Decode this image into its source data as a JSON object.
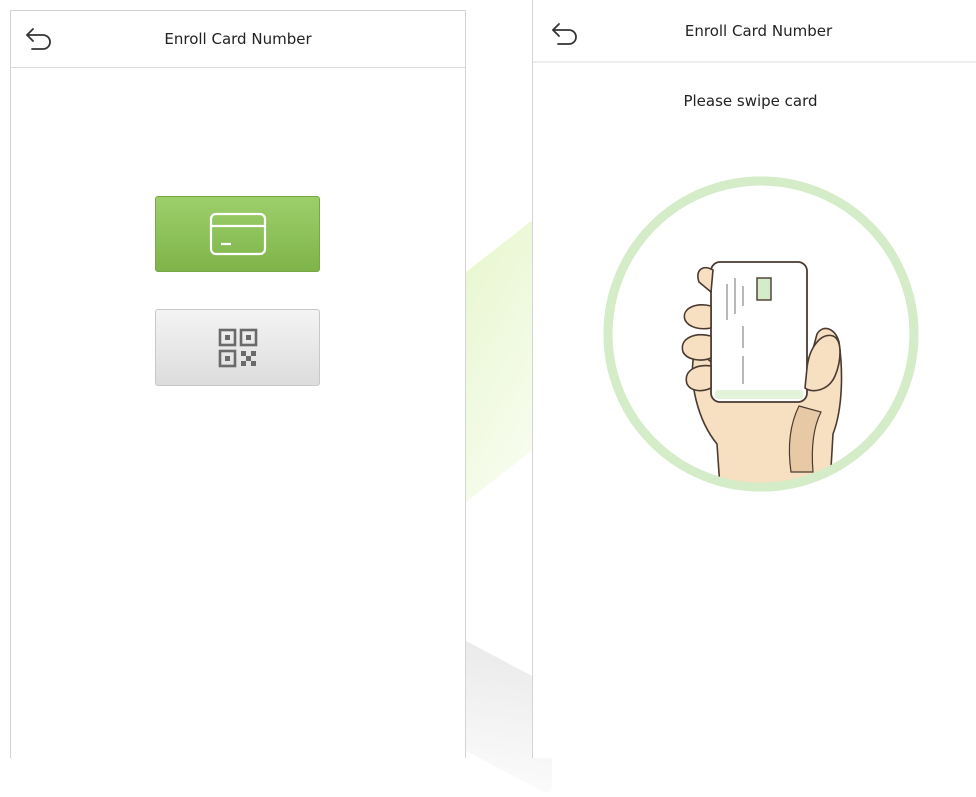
{
  "left_screen": {
    "title": "Enroll Card Number",
    "options": [
      {
        "name": "card",
        "icon": "card-icon",
        "color": "#8cc15a"
      },
      {
        "name": "qr-code",
        "icon": "qr-code-icon",
        "color": "#e6e6e6"
      }
    ]
  },
  "right_screen": {
    "title": "Enroll Card Number",
    "prompt": "Please swipe card",
    "illustration": "hand-holding-card-icon"
  },
  "colors": {
    "accent_green": "#8cc15a",
    "ring_green": "#d4ecc8",
    "skin": "#f7dfc2"
  }
}
